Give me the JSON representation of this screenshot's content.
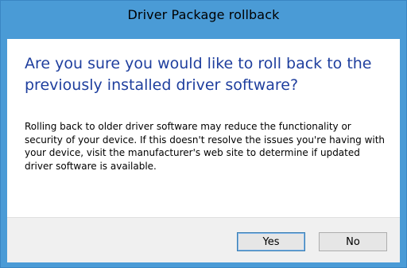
{
  "window": {
    "title": "Driver Package rollback"
  },
  "dialog": {
    "heading": "Are you sure you would like to roll back to the previously installed driver software?",
    "body": "Rolling back to older driver software may reduce the functionality or security of your device. If this doesn't resolve the issues you're having with your device, visit the manufacturer's web site to determine if updated driver software is available."
  },
  "buttons": {
    "yes_label": "Yes",
    "no_label": "No"
  },
  "colors": {
    "frame": "#4a9bd6",
    "heading": "#1f3f9e",
    "footer": "#f0f0f0"
  }
}
